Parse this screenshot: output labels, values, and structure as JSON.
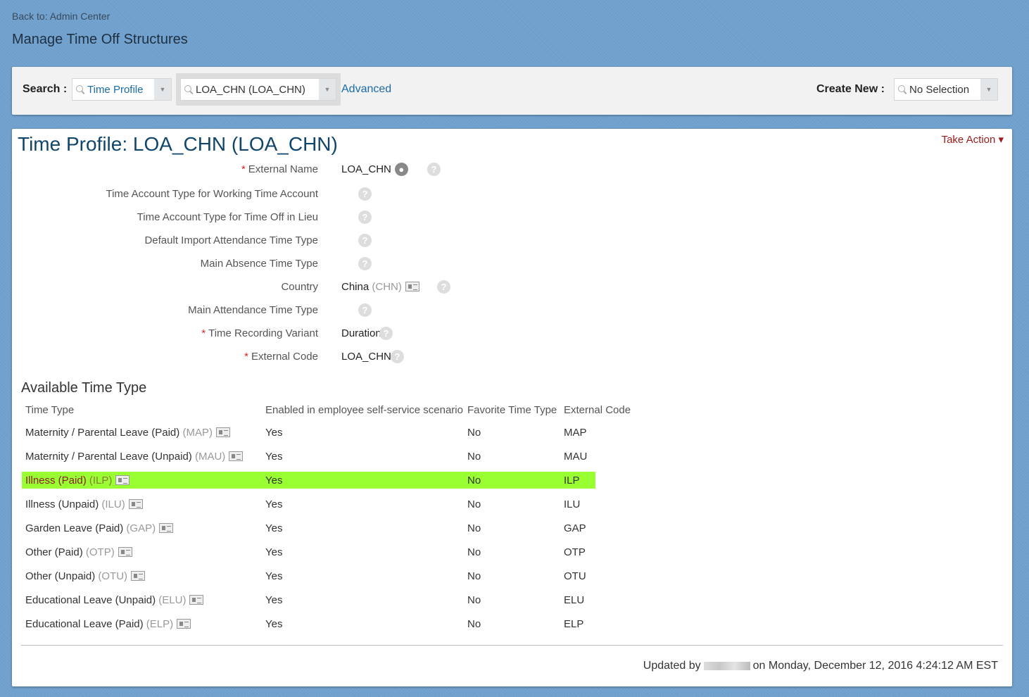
{
  "header": {
    "back": "Back to: Admin Center",
    "title": "Manage Time Off Structures"
  },
  "search": {
    "label": "Search :",
    "type": "Time Profile",
    "value": "LOA_CHN (LOA_CHN)",
    "advanced": "Advanced",
    "create_label": "Create New :",
    "create_value": "No Selection"
  },
  "profile": {
    "title": "Time Profile: LOA_CHN (LOA_CHN)",
    "take_action": "Take Action",
    "fields": [
      {
        "label": "External Name",
        "value": "LOA_CHN",
        "required": true
      },
      {
        "label": "Time Account Type for Working Time Account",
        "value": ""
      },
      {
        "label": "Time Account Type for Time Off in Lieu",
        "value": ""
      },
      {
        "label": "Default Import Attendance Time Type",
        "value": ""
      },
      {
        "label": "Main Absence Time Type",
        "value": ""
      },
      {
        "label": "Country",
        "value": "China",
        "code": "(CHN)"
      },
      {
        "label": "Main Attendance Time Type",
        "value": ""
      },
      {
        "label": "Time Recording Variant",
        "value": "Duration",
        "required": true
      },
      {
        "label": "External Code",
        "value": "LOA_CHN",
        "required": true
      }
    ]
  },
  "available": {
    "title": "Available Time Type",
    "columns": [
      "Time Type",
      "Enabled in employee self-service scenario",
      "Favorite Time Type",
      "External Code"
    ],
    "rows": [
      {
        "name": "Maternity / Parental Leave (Paid)",
        "code": "(MAP)",
        "ess": "Yes",
        "fav": "No",
        "ext": "MAP"
      },
      {
        "name": "Maternity / Parental Leave (Unpaid)",
        "code": "(MAU)",
        "ess": "Yes",
        "fav": "No",
        "ext": "MAU"
      },
      {
        "name": "Illness (Paid)",
        "code": "(ILP)",
        "ess": "Yes",
        "fav": "No",
        "ext": "ILP",
        "highlighted": true
      },
      {
        "name": "Illness (Unpaid)",
        "code": "(ILU)",
        "ess": "Yes",
        "fav": "No",
        "ext": "ILU"
      },
      {
        "name": "Garden Leave (Paid)",
        "code": "(GAP)",
        "ess": "Yes",
        "fav": "No",
        "ext": "GAP"
      },
      {
        "name": "Other (Paid)",
        "code": "(OTP)",
        "ess": "Yes",
        "fav": "No",
        "ext": "OTP"
      },
      {
        "name": "Other (Unpaid)",
        "code": "(OTU)",
        "ess": "Yes",
        "fav": "No",
        "ext": "OTU"
      },
      {
        "name": "Educational Leave (Unpaid)",
        "code": "(ELU)",
        "ess": "Yes",
        "fav": "No",
        "ext": "ELU"
      },
      {
        "name": "Educational Leave (Paid)",
        "code": "(ELP)",
        "ess": "Yes",
        "fav": "No",
        "ext": "ELP"
      }
    ]
  },
  "footer": {
    "updated_by": "Updated by",
    "updated_on": "on Monday, December 12, 2016 4:24:12 AM EST"
  },
  "colors": {
    "highlight": "#99ff33",
    "title": "#10466b",
    "link": "#1a6ba8",
    "take_action": "#9a1c1c"
  }
}
